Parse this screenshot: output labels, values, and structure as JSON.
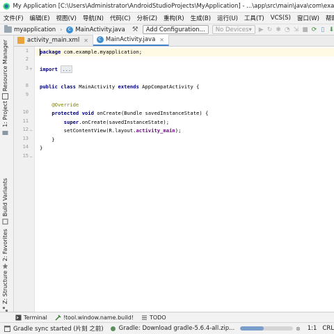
{
  "window": {
    "title": "My Application [C:\\Users\\Administrator\\AndroidStudioProjects\\MyApplication] - ...\\app\\src\\main\\java\\com\\example\\myapplica"
  },
  "menu": [
    "文件(F)",
    "编辑(E)",
    "视图(V)",
    "导航(N)",
    "代码(C)",
    "分析(Z)",
    "重构(R)",
    "生成(B)",
    "运行(U)",
    "工具(T)",
    "VCS(S)",
    "窗口(W)",
    "帮助(H)"
  ],
  "navbar": {
    "project": "myapplication",
    "file": "MainActivity.java",
    "config_button": "Add Configuration...",
    "devices": "No Devices"
  },
  "tabs": [
    {
      "label": "activity_main.xml",
      "icon": "xml-file-icon",
      "active": false
    },
    {
      "label": "MainActivity.java",
      "icon": "java-class-icon",
      "active": true
    }
  ],
  "left_tools": [
    "Resource Manager",
    "1: Project",
    "Build Variants",
    "2: Favorites",
    "Z: Structure"
  ],
  "code": {
    "line_numbers": [
      "1",
      "2",
      "3",
      "8",
      "9",
      "10",
      "11",
      "12",
      "13",
      "14",
      "15"
    ],
    "lines": [
      {
        "parts": [
          {
            "t": "package",
            "c": "kw"
          },
          {
            "t": " com.example.myapplication;",
            "c": ""
          }
        ]
      },
      {
        "parts": []
      },
      {
        "parts": [
          {
            "t": "import",
            "c": "kw"
          },
          {
            "t": " ",
            "c": ""
          },
          {
            "t": "...",
            "c": "fold-dots"
          }
        ]
      },
      {
        "parts": []
      },
      {
        "parts": [
          {
            "t": "public class",
            "c": "kw"
          },
          {
            "t": " MainActivity ",
            "c": ""
          },
          {
            "t": "extends",
            "c": "kw"
          },
          {
            "t": " AppCompatActivity {",
            "c": ""
          }
        ]
      },
      {
        "parts": []
      },
      {
        "parts": [
          {
            "t": "    ",
            "c": ""
          },
          {
            "t": "@Override",
            "c": "ann"
          }
        ]
      },
      {
        "parts": [
          {
            "t": "    ",
            "c": ""
          },
          {
            "t": "protected void",
            "c": "kw"
          },
          {
            "t": " onCreate(Bundle savedInstanceState) {",
            "c": ""
          }
        ]
      },
      {
        "parts": [
          {
            "t": "        ",
            "c": ""
          },
          {
            "t": "super",
            "c": "kw"
          },
          {
            "t": ".onCreate(savedInstanceState);",
            "c": ""
          }
        ]
      },
      {
        "parts": [
          {
            "t": "        setContentView(R.layout.",
            "c": ""
          },
          {
            "t": "activity_main",
            "c": "purple"
          },
          {
            "t": ");",
            "c": ""
          }
        ]
      },
      {
        "parts": [
          {
            "t": "    }",
            "c": ""
          }
        ]
      },
      {
        "parts": [
          {
            "t": "}",
            "c": ""
          }
        ]
      }
    ]
  },
  "bottom_tabs": [
    {
      "label": "Terminal",
      "icon": "terminal-icon"
    },
    {
      "label": "!tool.window.name.build!",
      "icon": "build-icon"
    },
    {
      "label": "TODO",
      "icon": "todo-icon"
    }
  ],
  "status": {
    "message": "Gradle sync started (片刻 之前)",
    "task": "Gradle: Download gradle-5.6.4-all.zip...",
    "progress": 0.45,
    "position": "1:1",
    "line_ending": "CRL"
  },
  "colors": {
    "accent": "#4083c9",
    "keyword": "#000080",
    "annotation": "#808000",
    "field": "#660e7a",
    "current_line": "#fffae3"
  }
}
